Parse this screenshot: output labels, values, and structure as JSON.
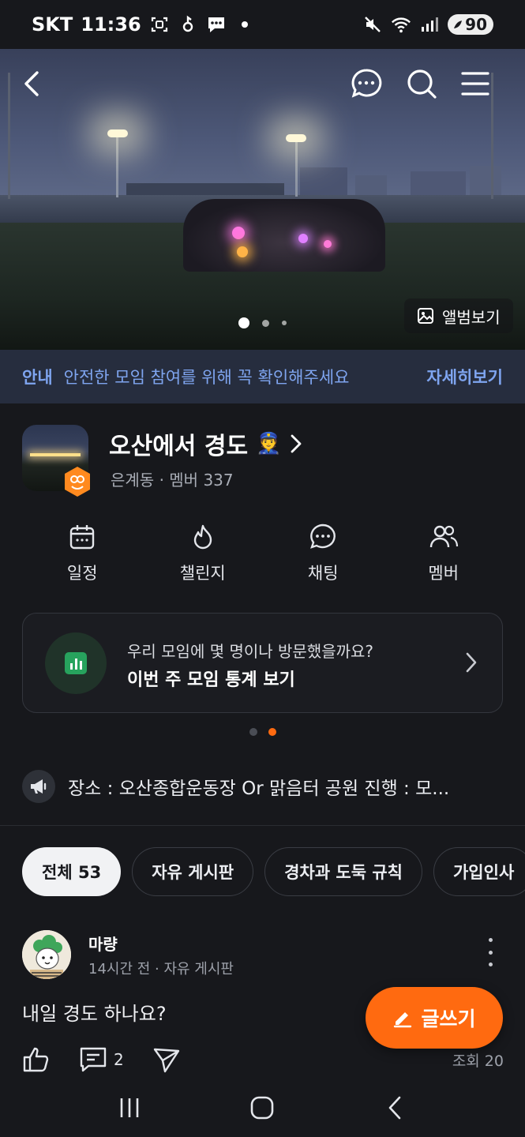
{
  "status_bar": {
    "carrier": "SKT",
    "time": "11:36",
    "battery": "90"
  },
  "hero": {
    "album_label": "앨범보기",
    "page_count": 3,
    "page_index": 0
  },
  "notice": {
    "tag": "안내",
    "message": "안전한 모임 참여를 위해 꼭 확인해주세요",
    "more": "자세히보기"
  },
  "club": {
    "name": "오산에서 경도",
    "emoji": "👮",
    "location": "은계동",
    "members": "멤버 337",
    "sep": "·"
  },
  "quick_menu": [
    {
      "label": "일정",
      "icon": "calendar-icon"
    },
    {
      "label": "챌린지",
      "icon": "flame-icon"
    },
    {
      "label": "채팅",
      "icon": "chat-icon"
    },
    {
      "label": "멤버",
      "icon": "members-icon"
    }
  ],
  "stats_card": {
    "line1": "우리 모임에 몇 명이나 방문했을까요?",
    "line2": "이번 주 모임 통계 보기",
    "page_index": 1,
    "page_count": 2
  },
  "announcement": {
    "text": "장소 : 오산종합운동장 Or 맑음터 공원 진행 : 모..."
  },
  "tabs": [
    {
      "label": "전체 53",
      "active": true
    },
    {
      "label": "자유 게시판",
      "active": false
    },
    {
      "label": "경차과 도둑 규칙",
      "active": false
    },
    {
      "label": "가입인사",
      "active": false
    }
  ],
  "post": {
    "author": "마량",
    "meta": "14시간 전 · 자유 게시판",
    "body": "내일 경도 하나요?",
    "comments": "2",
    "views": "조회 20"
  },
  "fab": {
    "label": "글쓰기"
  },
  "colors": {
    "accent": "#ff6a10",
    "notice_text": "#7fa5f0",
    "background": "#17181c"
  }
}
